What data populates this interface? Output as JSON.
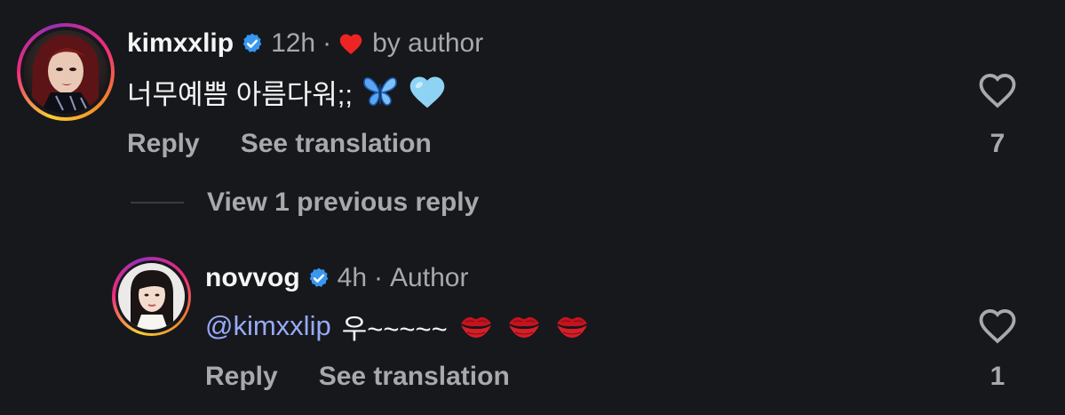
{
  "comment": {
    "username": "kimxxlip",
    "time": "12h",
    "separator": "·",
    "liked_by_label": "by author",
    "text": "너무예쁨 아름다워;;",
    "emojis": [
      "butterfly",
      "light-blue-heart"
    ],
    "actions": {
      "reply": "Reply",
      "translate": "See translation"
    },
    "likes": "7"
  },
  "view_replies": {
    "label": "View 1 previous reply"
  },
  "reply": {
    "username": "novvog",
    "time": "4h",
    "separator": "·",
    "role": "Author",
    "mention": "@kimxxlip",
    "text": "우~~~~~",
    "emojis": [
      "kiss-mark",
      "kiss-mark",
      "kiss-mark"
    ],
    "actions": {
      "reply": "Reply",
      "translate": "See translation"
    },
    "likes": "1"
  },
  "colors": {
    "background": "#16181c",
    "primary_text": "#f5f5f5",
    "secondary_text": "#a8a8ad",
    "verified_blue": "#3897f0",
    "liked_heart": "#ed2424",
    "mention": "#98a9f7"
  }
}
